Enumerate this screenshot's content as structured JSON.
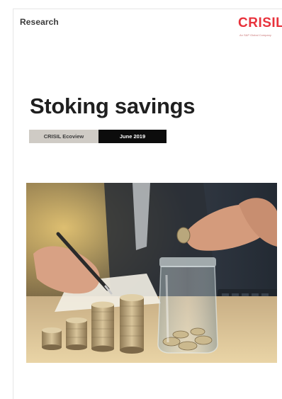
{
  "header": {
    "section_label": "Research"
  },
  "logo": {
    "name": "CRISIL",
    "tagline": "An S&P Global Company",
    "color": "#e8323c"
  },
  "cover": {
    "title": "Stoking savings",
    "series": "CRISIL Ecoview",
    "date": "June 2019"
  },
  "photo": {
    "subject": "hand dropping coins into a glass jar beside stacks of coins, person writing in background"
  },
  "colors": {
    "series_bg": "#cfcbc5",
    "date_bg": "#0c0c0c",
    "title": "#1f1f1f"
  }
}
